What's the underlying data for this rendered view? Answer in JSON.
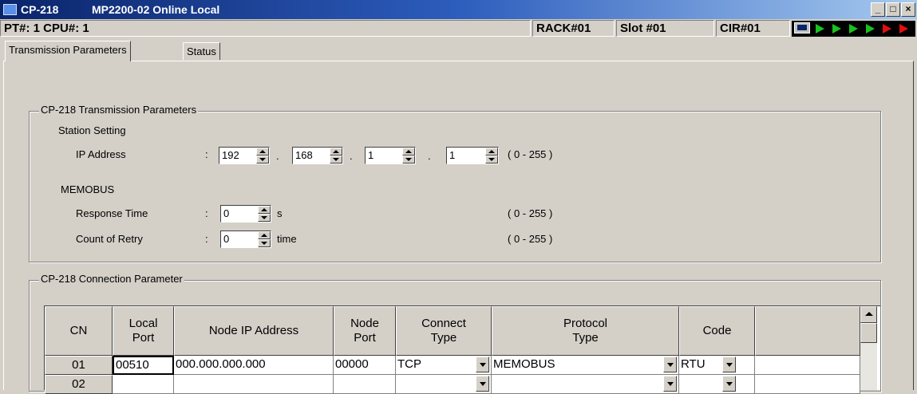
{
  "window": {
    "title_module": "CP-218",
    "title_status": "MP2200-02 Online  Local",
    "min_glyph": "_",
    "max_glyph": "□",
    "close_glyph": "×"
  },
  "infobar": {
    "pt_cpu": "PT#: 1 CPU#: 1",
    "rack": "RACK#01",
    "slot": "Slot #01",
    "cir": "CIR#01",
    "run_indicator": {
      "arrow_colors": [
        "#19c11f",
        "#19c11f",
        "#19c11f",
        "#19c11f",
        "#e01010",
        "#e01010"
      ]
    }
  },
  "tabs": [
    {
      "label": "Transmission Parameters",
      "active": true
    },
    {
      "label": "Status",
      "active": false
    }
  ],
  "transmission": {
    "group_title": "CP-218 Transmission Parameters",
    "station_setting_label": "Station Setting",
    "ip_label": "IP Address",
    "colon": ":",
    "dot": ".",
    "ip_octets": [
      "192",
      "168",
      "1",
      "1"
    ],
    "range": "( 0 - 255 )",
    "memobus_label": "MEMOBUS",
    "response_time_label": "Response Time",
    "response_time_value": "0",
    "response_time_unit": "s",
    "retry_label": "Count of Retry",
    "retry_value": "0",
    "retry_unit": "time"
  },
  "connection": {
    "group_title": "CP-218 Connection Parameter",
    "headers": {
      "cn": "CN",
      "local_port_1": "Local",
      "local_port_2": "Port",
      "node_ip": "Node IP Address",
      "node_port_1": "Node",
      "node_port_2": "Port",
      "connect_type_1": "Connect",
      "connect_type_2": "Type",
      "protocol_type_1": "Protocol",
      "protocol_type_2": "Type",
      "code": "Code"
    },
    "rows": [
      {
        "cn": "01",
        "local_port": "00510",
        "node_ip": "000.000.000.000",
        "node_port": "00000",
        "connect_type": "TCP",
        "protocol_type": "MEMOBUS",
        "code": "RTU"
      },
      {
        "cn": "02",
        "local_port": "",
        "node_ip": "",
        "node_port": "",
        "connect_type": "",
        "protocol_type": "",
        "code": ""
      }
    ]
  }
}
